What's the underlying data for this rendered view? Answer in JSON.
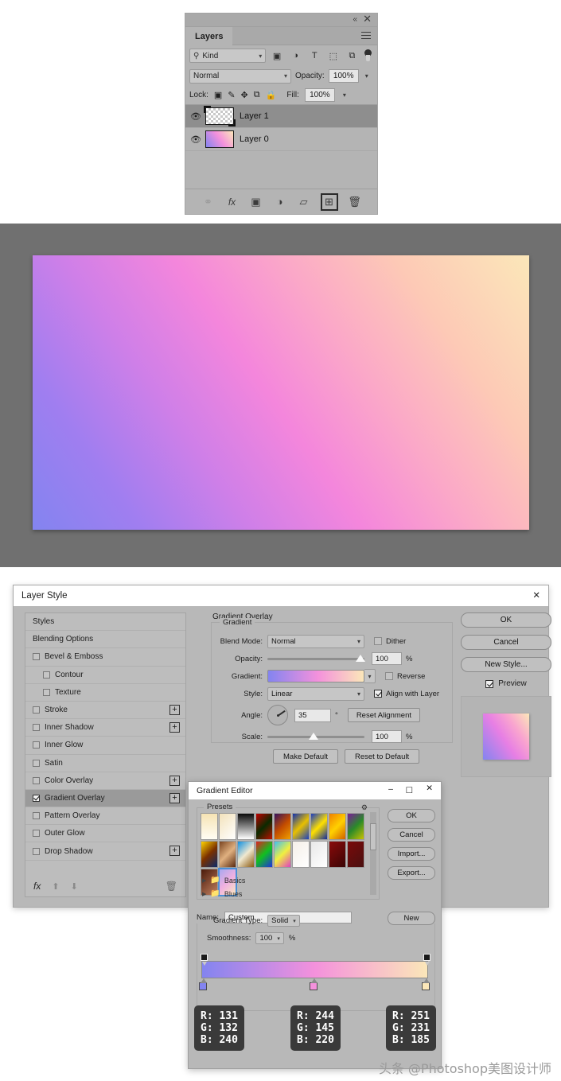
{
  "layers_panel": {
    "tab_label": "Layers",
    "collapse_icon": "double-chevron-left-icon",
    "close_icon": "close-icon",
    "menu_icon": "panel-menu-icon",
    "filter": {
      "search_icon": "search-icon",
      "kind_label": "Kind",
      "chevron": "⌄",
      "icons": [
        "pixel-layer-filter-icon",
        "adjustment-layer-filter-icon",
        "type-layer-filter-icon",
        "shape-layer-filter-icon",
        "smart-object-filter-icon"
      ],
      "icon_glyphs": [
        "▣",
        "◑",
        "T",
        "⬚",
        "⧉"
      ]
    },
    "blend_mode": "Normal",
    "opacity_label": "Opacity:",
    "opacity_value": "100%",
    "lock_label": "Lock:",
    "lock_icons": [
      "lock-transparent-pixels-icon",
      "lock-image-pixels-icon",
      "lock-position-icon",
      "lock-artboard-nesting-icon",
      "lock-all-icon"
    ],
    "lock_glyphs": [
      "⬚",
      "✒",
      "✥",
      "⧉",
      "🔒"
    ],
    "fill_label": "Fill:",
    "fill_value": "100%",
    "layers": [
      {
        "name": "Layer 1",
        "selected": true,
        "thumb": "transparent",
        "visible": true
      },
      {
        "name": "Layer 0",
        "selected": false,
        "thumb": "gradient",
        "visible": true
      }
    ],
    "bottom_icons": [
      {
        "name": "link-layers-icon",
        "glyph": "⚭",
        "dim": true,
        "highlight": false
      },
      {
        "name": "layer-effects-fx-icon",
        "glyph": "fx",
        "dim": false,
        "highlight": false
      },
      {
        "name": "add-layer-mask-icon",
        "glyph": "▣",
        "dim": false,
        "highlight": false
      },
      {
        "name": "new-adjustment-layer-icon",
        "glyph": "◑",
        "dim": false,
        "highlight": false
      },
      {
        "name": "new-group-icon",
        "glyph": "▱",
        "dim": false,
        "highlight": false
      },
      {
        "name": "new-layer-icon",
        "glyph": "⊞",
        "dim": false,
        "highlight": true
      },
      {
        "name": "delete-layer-icon",
        "glyph": "🗑",
        "dim": false,
        "highlight": false
      }
    ]
  },
  "canvas": {
    "name": "document-canvas",
    "gradient_angle_deg": 35,
    "colors": [
      "#8384f0",
      "#f491dc",
      "#fbe7b9"
    ]
  },
  "layer_style": {
    "title": "Layer Style",
    "close_icon": "close-icon",
    "styles": [
      {
        "label": "Styles",
        "checkbox": false,
        "checked": false,
        "plus": false,
        "indent": false,
        "active": false
      },
      {
        "label": "Blending Options",
        "checkbox": false,
        "checked": false,
        "plus": false,
        "indent": false,
        "active": false
      },
      {
        "label": "Bevel & Emboss",
        "checkbox": true,
        "checked": false,
        "plus": false,
        "indent": false,
        "active": false
      },
      {
        "label": "Contour",
        "checkbox": true,
        "checked": false,
        "plus": false,
        "indent": true,
        "active": false
      },
      {
        "label": "Texture",
        "checkbox": true,
        "checked": false,
        "plus": false,
        "indent": true,
        "active": false
      },
      {
        "label": "Stroke",
        "checkbox": true,
        "checked": false,
        "plus": true,
        "indent": false,
        "active": false
      },
      {
        "label": "Inner Shadow",
        "checkbox": true,
        "checked": false,
        "plus": true,
        "indent": false,
        "active": false
      },
      {
        "label": "Inner Glow",
        "checkbox": true,
        "checked": false,
        "plus": false,
        "indent": false,
        "active": false
      },
      {
        "label": "Satin",
        "checkbox": true,
        "checked": false,
        "plus": false,
        "indent": false,
        "active": false
      },
      {
        "label": "Color Overlay",
        "checkbox": true,
        "checked": false,
        "plus": true,
        "indent": false,
        "active": false
      },
      {
        "label": "Gradient Overlay",
        "checkbox": true,
        "checked": true,
        "plus": true,
        "indent": false,
        "active": true
      },
      {
        "label": "Pattern Overlay",
        "checkbox": true,
        "checked": false,
        "plus": false,
        "indent": false,
        "active": false
      },
      {
        "label": "Outer Glow",
        "checkbox": true,
        "checked": false,
        "plus": false,
        "indent": false,
        "active": false
      },
      {
        "label": "Drop Shadow",
        "checkbox": true,
        "checked": false,
        "plus": true,
        "indent": false,
        "active": false
      }
    ],
    "styles_footer": {
      "fx_icon": "fx-icon",
      "fx_label": "fx",
      "up_icon": "arrow-up-icon",
      "down_icon": "arrow-down-icon",
      "trash_icon": "trash-icon"
    },
    "gradient_overlay": {
      "section_title": "Gradient Overlay",
      "group_title": "Gradient",
      "blend_mode_label": "Blend Mode:",
      "blend_mode_value": "Normal",
      "dither_label": "Dither",
      "dither_checked": false,
      "opacity_label": "Opacity:",
      "opacity_value": "100",
      "opacity_pct": "%",
      "gradient_label": "Gradient:",
      "reverse_label": "Reverse",
      "reverse_checked": false,
      "style_label": "Style:",
      "style_value": "Linear",
      "align_label": "Align with Layer",
      "align_checked": true,
      "angle_label": "Angle:",
      "angle_value": "35",
      "angle_unit": "°",
      "reset_alignment_label": "Reset Alignment",
      "scale_label": "Scale:",
      "scale_value": "100",
      "scale_pct": "%",
      "make_default_label": "Make Default",
      "reset_default_label": "Reset to Default"
    },
    "buttons": {
      "ok": "OK",
      "cancel": "Cancel",
      "new_style": "New Style...",
      "preview_label": "Preview",
      "preview_checked": true
    }
  },
  "gradient_editor": {
    "title": "Gradient Editor",
    "minimize_icon": "minimize-icon",
    "maximize_icon": "maximize-icon",
    "close_icon": "close-icon",
    "presets_label": "Presets",
    "gear_icon": "gear-icon",
    "swatches": [
      "linear-gradient(180deg,#f6e3b4,#fffdf4)",
      "linear-gradient(135deg,#f3e2bb,#ffffff)",
      "linear-gradient(180deg,#0a0a0a,#ffffff)",
      "linear-gradient(135deg,#c00000,#0a2a00,#bb1100)",
      "linear-gradient(135deg,#35135e,#c24b00,#f0a000)",
      "linear-gradient(135deg,#1030b0,#e8c000,#1a40c0)",
      "linear-gradient(135deg,#1a3cc0,#ffe000,#0f2aa0)",
      "linear-gradient(135deg,#f08000,#ffd000,#d06000)",
      "linear-gradient(135deg,#7a1b9a,#2a8a2a,#c8c000)",
      "linear-gradient(135deg,#ffd400,#7a3000,#0a2a6a)",
      "linear-gradient(135deg,#7a4420,#e0b080,#5a2a10)",
      "linear-gradient(135deg,#1090e0,#f0e8d0,#8a5a10)",
      "linear-gradient(135deg,#e02020,#10c020,#2030e0)",
      "linear-gradient(135deg,#40c0f0,#f0f040,#e040c0)",
      "linear-gradient(135deg,#f5f0e8,#ffffff)",
      "linear-gradient(135deg,#e8e8e8,#ffffff)",
      "linear-gradient(135deg,#8a0a0a,#3a0505)",
      "linear-gradient(135deg,#7a0a0a,#4a1010)",
      "linear-gradient(135deg,#4a1a0a,#c08060)",
      "linear-gradient(135deg,#a8a8f0,#f0b0e0,#f8e8c0)"
    ],
    "selected_swatch_index": 19,
    "folders": [
      "Basics",
      "Blues"
    ],
    "name_label": "Name:",
    "name_value": "Custom",
    "new_button": "New",
    "ok_button": "OK",
    "cancel_button": "Cancel",
    "import_button": "Import...",
    "export_button": "Export...",
    "gradient_type_label": "Gradient Type:",
    "gradient_type_value": "Solid",
    "smoothness_label": "Smoothness:",
    "smoothness_value": "100",
    "smoothness_pct": "%",
    "gradient_stops": [
      {
        "position": 0,
        "color": "#8384f0"
      },
      {
        "position": 50,
        "color": "#f491dc"
      },
      {
        "position": 100,
        "color": "#fbe7b9"
      }
    ]
  },
  "callouts": [
    {
      "r": "R: 131",
      "g": "G: 132",
      "b": "B: 240"
    },
    {
      "r": "R: 244",
      "g": "G: 145",
      "b": "B: 220"
    },
    {
      "r": "R: 251",
      "g": "G: 231",
      "b": "B: 185"
    }
  ],
  "watermark": "头条 @Photoshop美图设计师"
}
